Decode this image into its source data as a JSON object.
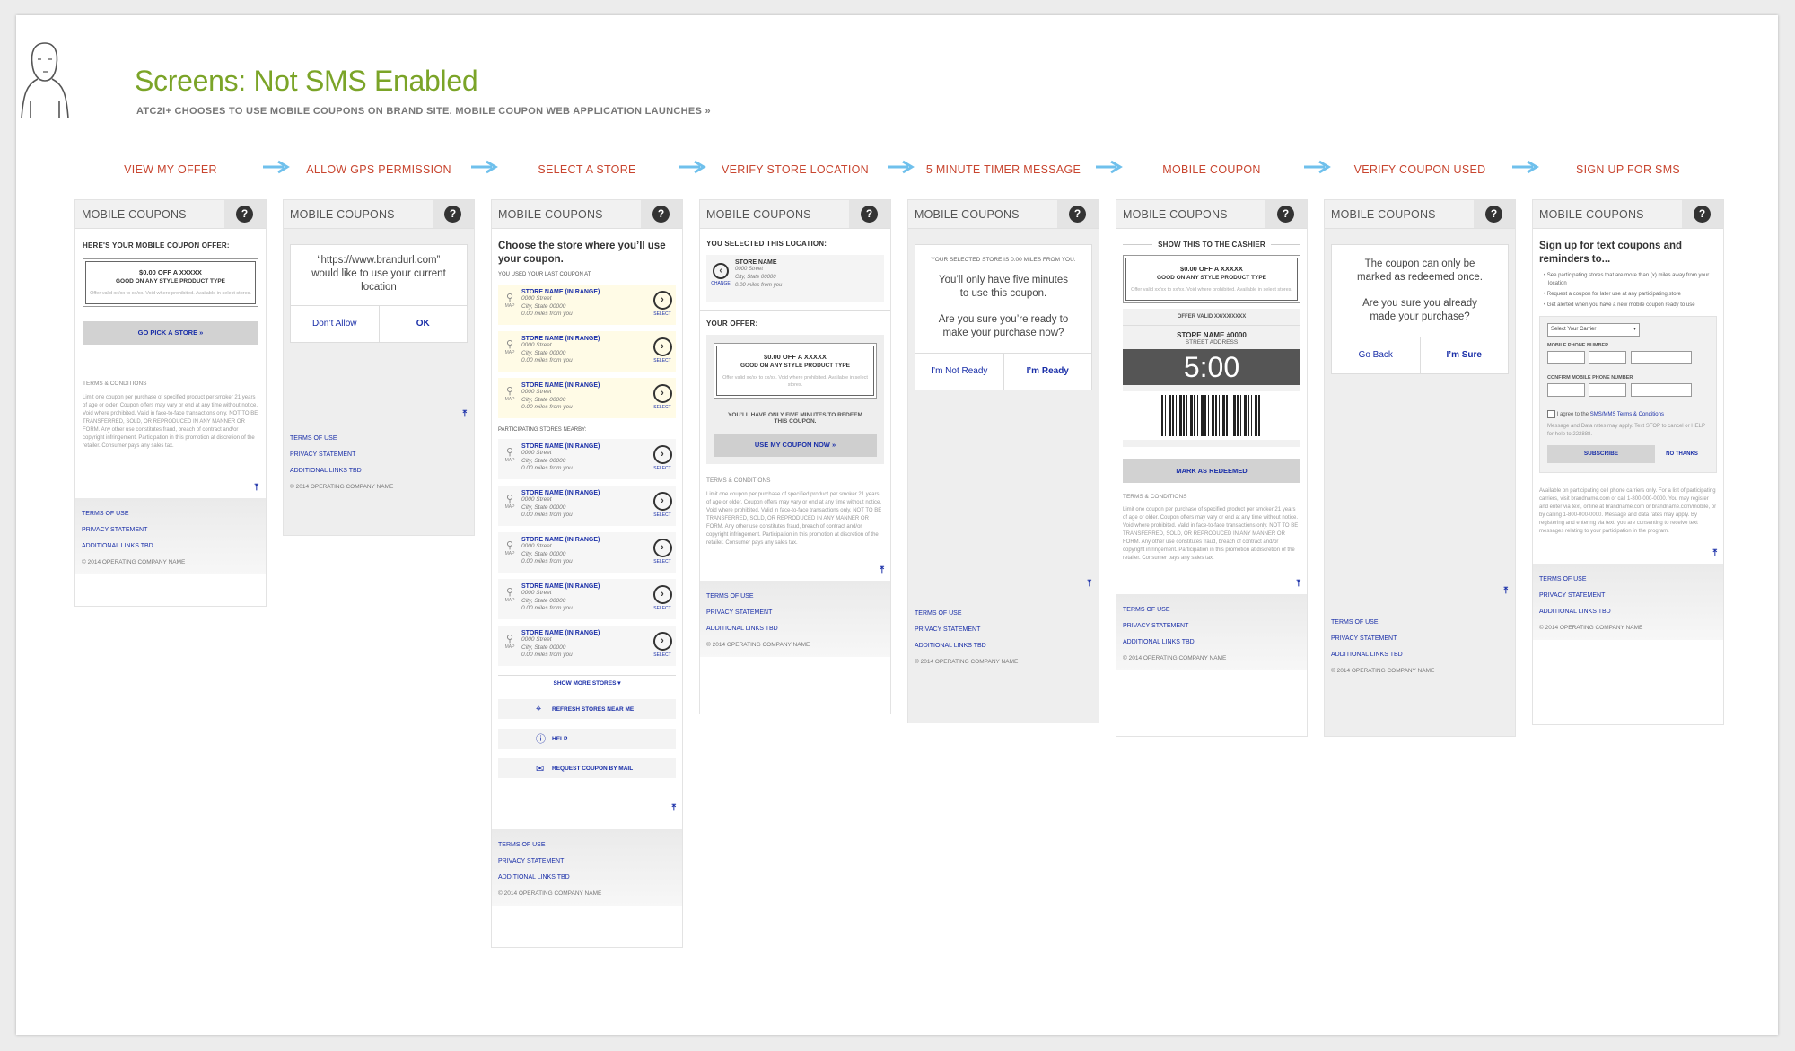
{
  "page": {
    "title": "Screens: Not SMS Enabled",
    "subtitle": "ATC2I+ CHOOSES TO USE MOBILE COUPONS ON BRAND SITE. MOBILE COUPON WEB APPLICATION LAUNCHES »"
  },
  "steps": [
    "VIEW MY OFFER",
    "ALLOW GPS PERMISSION",
    "SELECT A STORE",
    "VERIFY STORE LOCATION",
    "5 MINUTE TIMER MESSAGE",
    "MOBILE COUPON",
    "VERIFY COUPON USED",
    "SIGN UP FOR SMS"
  ],
  "colors": {
    "step_label": "#c8452f",
    "arrow": "#6fc0ec",
    "title": "#7ba428",
    "link": "#1a2fa8"
  },
  "common": {
    "screen_title": "MOBILE COUPONS",
    "help_glyph": "?",
    "to_top_glyph": "⤒",
    "footer_links": [
      "TERMS OF USE",
      "PRIVACY STATEMENT",
      "ADDITIONAL LINKS TBD"
    ],
    "copyright": "© 2014 OPERATING COMPANY NAME",
    "terms_heading": "TERMS & CONDITIONS",
    "terms_text": "Limit one coupon per purchase of specified product per smoker 21 years of age or older. Coupon offers may vary or end at any time without notice. Void where prohibited. Valid in face-to-face transactions only. NOT TO BE TRANSFERRED, SOLD, OR REPRODUCED IN ANY MANNER OR FORM. Any other use constitutes fraud, breach of contract and/or copyright infringement. Participation in this promotion at discretion of the retailer. Consumer pays any sales tax.",
    "offer": {
      "line1": "$0.00 OFF A XXXXX",
      "line2": "GOOD ON ANY STYLE PRODUCT TYPE",
      "fine": "Offer valid xx/xx to xx/xx. Void where prohibited. Available in select stores."
    }
  },
  "s1": {
    "heading": "HERE'S YOUR MOBILE COUPON OFFER:",
    "button": "GO PICK A STORE »"
  },
  "s2": {
    "message": "“https://www.brandurl.com” would like to use your current location",
    "deny": "Don’t Allow",
    "ok": "OK"
  },
  "s3": {
    "heading": "Choose the store where you’ll use your coupon.",
    "last_label": "YOU USED YOUR LAST COUPON AT:",
    "nearby_label": "PARTICIPATING STORES NEARBY:",
    "map_label": "MAP",
    "select_label": "SELECT",
    "store": {
      "name": "STORE NAME (IN RANGE)",
      "street": "0000 Street",
      "city": "City, State 00000",
      "distance": "0.00 miles from you"
    },
    "show_more": "SHOW MORE STORES",
    "actions": [
      "REFRESH STORES NEAR ME",
      "HELP",
      "REQUEST COUPON BY MAIL"
    ]
  },
  "s4": {
    "heading": "YOU SELECTED THIS LOCATION:",
    "change": "CHANGE",
    "store_name": "STORE NAME",
    "street": "0000 Street",
    "city": "City, State 00000",
    "distance": "0.00 miles from you",
    "offer_label": "YOUR OFFER:",
    "note": "YOU’LL HAVE ONLY FIVE MINUTES TO REDEEM THIS COUPON.",
    "button": "USE MY COUPON NOW »"
  },
  "s5": {
    "top": "YOUR SELECTED STORE IS 0.00 MILES FROM YOU.",
    "msg1": "You’ll only have five minutes to use this coupon.",
    "msg2": "Are you sure you’re ready to make your purchase now?",
    "no": "I’m Not Ready",
    "yes": "I’m Ready"
  },
  "s6": {
    "show": "SHOW THIS TO THE CASHIER",
    "valid": "OFFER VALID XX/XX/XXXX",
    "store": "STORE NAME #0000",
    "address": "STREET ADDRESS",
    "timer": "5:00",
    "button": "MARK AS REDEEMED"
  },
  "s7": {
    "msg1": "The coupon can only be marked as redeemed once.",
    "msg2": "Are you sure you already made your purchase?",
    "back": "Go Back",
    "sure": "I’m Sure"
  },
  "s8": {
    "heading": "Sign up for text coupons and reminders to...",
    "bullets": [
      "See participating stores that are more than (x) miles away from your location",
      "Request a coupon for later use at any participating store",
      "Get alerted when you have a new mobile coupon ready to use"
    ],
    "carrier": "Select Your Carrier",
    "phone_label": "MOBILE PHONE NUMBER",
    "confirm_label": "CONFIRM MOBILE PHONE NUMBER",
    "agree": "I agree to the",
    "agree_link": "SMS/MMS Terms & Conditions",
    "rates": "Message and Data rates may apply. Text STOP to cancel or HELP for help to 222888.",
    "subscribe": "SUBSCRIBE",
    "no_thanks": "NO THANKS",
    "legal": "Available on participating cell phone carriers only. For a list of participating carriers, visit brandname.com or call 1-800-000-0000. You may register and enter via text, online at brandname.com or brandname.com/mobile, or by calling 1-800-000-0000. Message and data rates may apply. By registering and entering via text, you are consenting to receive text messages relating to your participation in the program."
  }
}
